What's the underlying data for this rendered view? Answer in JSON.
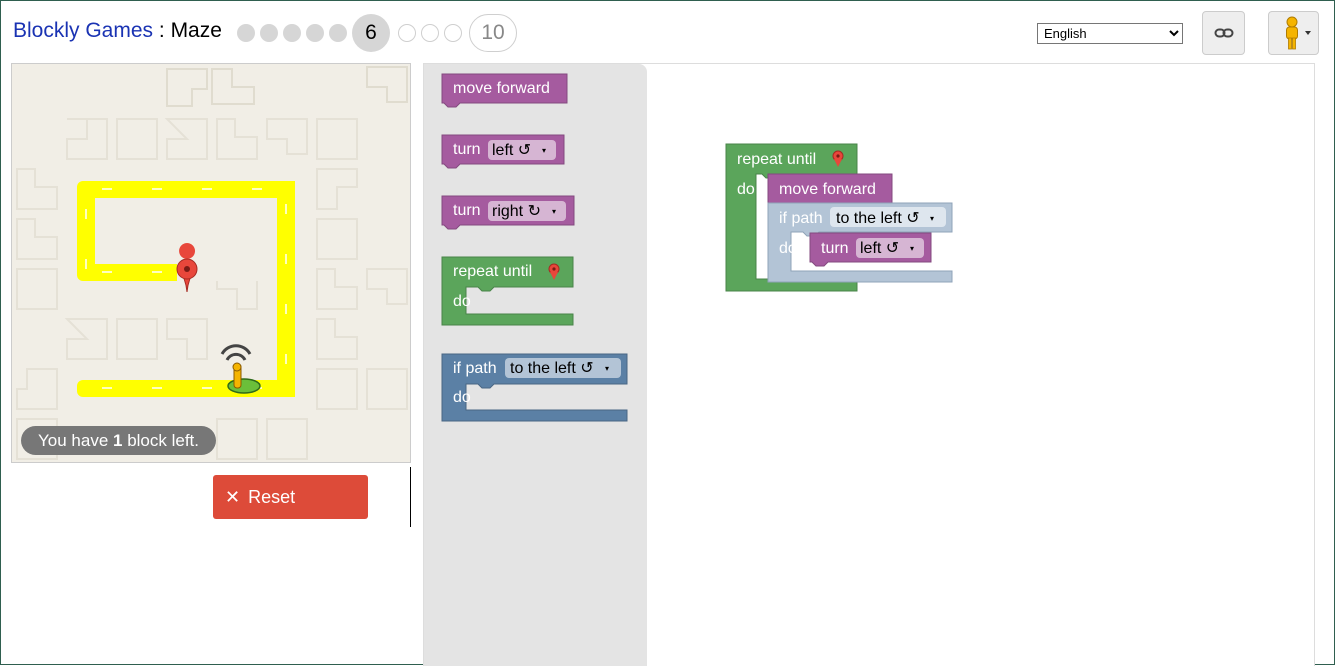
{
  "header": {
    "brand": "Blockly Games",
    "separator": " : ",
    "game": "Maze",
    "current_level": "6",
    "last_level": "10",
    "language": "English",
    "language_options": [
      "English"
    ]
  },
  "maze": {
    "capacity_prefix": "You have ",
    "capacity_count": "1",
    "capacity_suffix": " block left."
  },
  "controls": {
    "reset_label": "Reset",
    "reset_icon": "✕"
  },
  "toolbox": {
    "move_forward": "move forward",
    "turn": "turn",
    "left_option": "left ↺",
    "right_option": "right ↻",
    "repeat_until": "repeat until",
    "do": "do",
    "if_path": "if path",
    "to_the_left": "to the left ↺",
    "dropdown_arrow": "▾"
  },
  "program": {
    "repeat_until": "repeat until",
    "do": "do",
    "move_forward": "move forward",
    "if_path": "if path",
    "to_the_left": "to the left ↺",
    "if_do": "do",
    "turn": "turn",
    "left_option": "left ↺",
    "dropdown_arrow": "▾"
  },
  "colors": {
    "movement": "#a55b9f",
    "loop": "#5ba55b",
    "logic": "#5b80a5",
    "path": "#ffff00",
    "reset": "#dd4b39"
  }
}
